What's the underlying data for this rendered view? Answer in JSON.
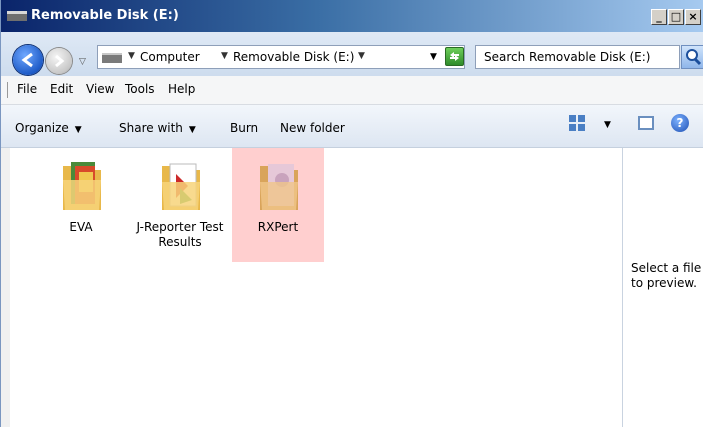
{
  "window": {
    "title": "Removable Disk (E:)",
    "caption_buttons": [
      "_",
      "□",
      "×"
    ]
  },
  "address": {
    "crumbs": [
      "Computer",
      "Removable Disk (E:)"
    ],
    "search_placeholder": "Search Removable Disk (E:)"
  },
  "menu": [
    "File",
    "Edit",
    "View",
    "Tools",
    "Help"
  ],
  "commands": {
    "organize": "Organize",
    "share_with": "Share with",
    "burn": "Burn",
    "new_folder": "New folder"
  },
  "help_glyph": "?",
  "items": [
    {
      "name": "EVA",
      "selected": false,
      "icon": "folder-icon"
    },
    {
      "name": "J-Reporter Test Results",
      "selected": false,
      "icon": "folder-icon"
    },
    {
      "name": "RXPert",
      "selected": true,
      "icon": "folder-icon"
    }
  ],
  "preview": {
    "message": "Select a file to preview."
  },
  "colors": {
    "selection": "#ffcfcf",
    "titlebar": "#0a246a"
  }
}
